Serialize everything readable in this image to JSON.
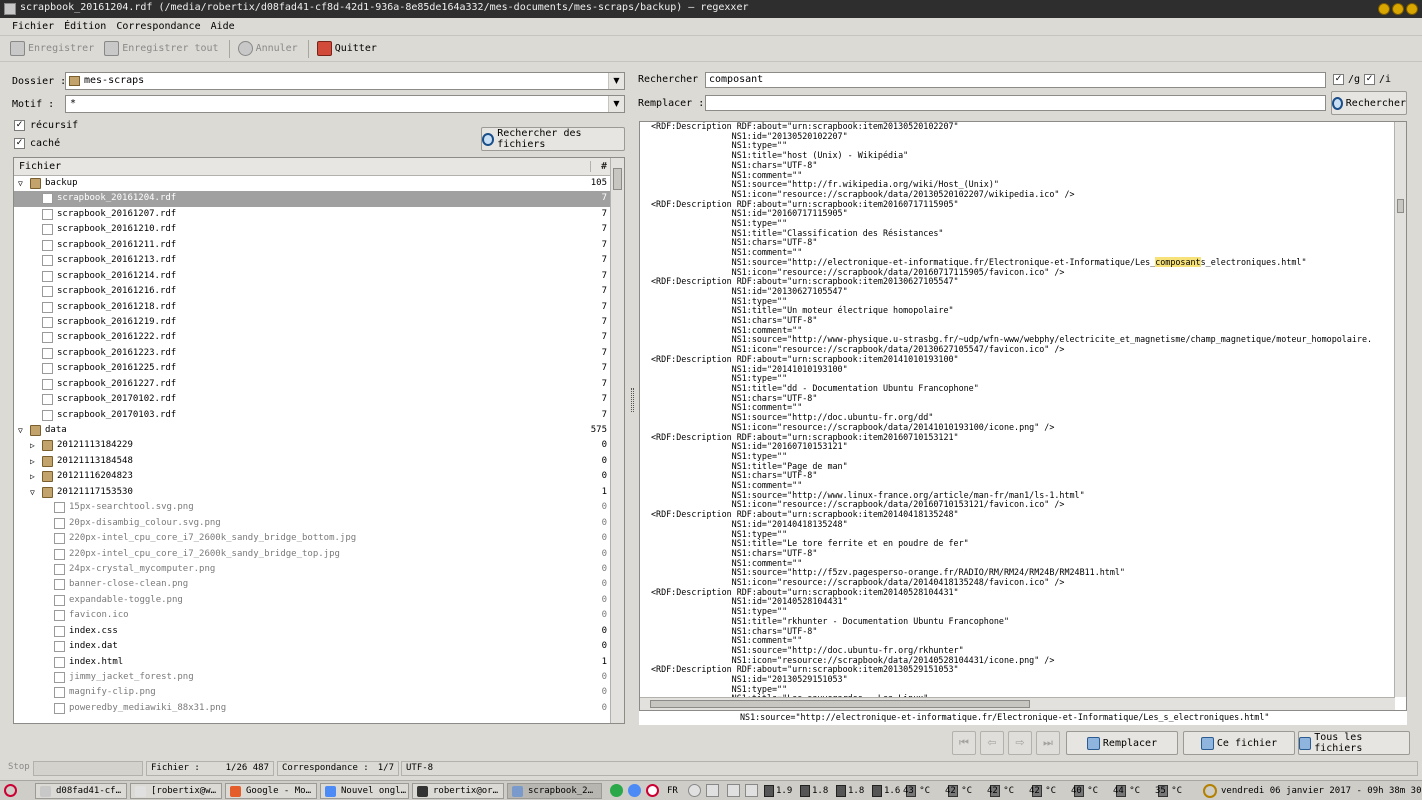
{
  "window": {
    "title": "scrapbook_20161204.rdf (/media/robertix/d08fad41-cf8d-42d1-936a-8e85de164a332/mes-documents/mes-scraps/backup) – regexxer"
  },
  "menu": [
    "Fichier",
    "Édition",
    "Correspondance",
    "Aide"
  ],
  "toolbar": {
    "save": "Enregistrer",
    "save_all": "Enregistrer tout",
    "undo": "Annuler",
    "quit": "Quitter"
  },
  "left": {
    "folder_label": "Dossier :",
    "folder_value": "mes-scraps",
    "pattern_label": "Motif :",
    "pattern_value": "*",
    "recursive_label": "récursif",
    "hidden_label": "caché",
    "find_files_btn": "Rechercher des fichiers",
    "col_file": "Fichier",
    "col_count": "#",
    "rows": [
      {
        "name": "backup",
        "count": "105",
        "type": "folder",
        "level": 0,
        "expander": "▽"
      },
      {
        "name": "scrapbook_20161204.rdf",
        "count": "7",
        "type": "file",
        "level": 1,
        "selected": true
      },
      {
        "name": "scrapbook_20161207.rdf",
        "count": "7",
        "type": "file",
        "level": 1
      },
      {
        "name": "scrapbook_20161210.rdf",
        "count": "7",
        "type": "file",
        "level": 1
      },
      {
        "name": "scrapbook_20161211.rdf",
        "count": "7",
        "type": "file",
        "level": 1
      },
      {
        "name": "scrapbook_20161213.rdf",
        "count": "7",
        "type": "file",
        "level": 1
      },
      {
        "name": "scrapbook_20161214.rdf",
        "count": "7",
        "type": "file",
        "level": 1
      },
      {
        "name": "scrapbook_20161216.rdf",
        "count": "7",
        "type": "file",
        "level": 1
      },
      {
        "name": "scrapbook_20161218.rdf",
        "count": "7",
        "type": "file",
        "level": 1
      },
      {
        "name": "scrapbook_20161219.rdf",
        "count": "7",
        "type": "file",
        "level": 1
      },
      {
        "name": "scrapbook_20161222.rdf",
        "count": "7",
        "type": "file",
        "level": 1
      },
      {
        "name": "scrapbook_20161223.rdf",
        "count": "7",
        "type": "file",
        "level": 1
      },
      {
        "name": "scrapbook_20161225.rdf",
        "count": "7",
        "type": "file",
        "level": 1
      },
      {
        "name": "scrapbook_20161227.rdf",
        "count": "7",
        "type": "file",
        "level": 1
      },
      {
        "name": "scrapbook_20170102.rdf",
        "count": "7",
        "type": "file",
        "level": 1
      },
      {
        "name": "scrapbook_20170103.rdf",
        "count": "7",
        "type": "file",
        "level": 1
      },
      {
        "name": "data",
        "count": "575",
        "type": "folder",
        "level": 0,
        "expander": "▽"
      },
      {
        "name": "20121113184229",
        "count": "0",
        "type": "folder",
        "level": 1,
        "expander": "▷"
      },
      {
        "name": "20121113184548",
        "count": "0",
        "type": "folder",
        "level": 1,
        "expander": "▷"
      },
      {
        "name": "20121116204823",
        "count": "0",
        "type": "folder",
        "level": 1,
        "expander": "▷"
      },
      {
        "name": "20121117153530",
        "count": "1",
        "type": "folder",
        "level": 1,
        "expander": "▽"
      },
      {
        "name": "15px-searchtool.svg.png",
        "count": "0",
        "type": "file",
        "level": 2,
        "dim": true
      },
      {
        "name": "20px-disambig_colour.svg.png",
        "count": "0",
        "type": "file",
        "level": 2,
        "dim": true
      },
      {
        "name": "220px-intel_cpu_core_i7_2600k_sandy_bridge_bottom.jpg",
        "count": "0",
        "type": "file",
        "level": 2,
        "dim": true
      },
      {
        "name": "220px-intel_cpu_core_i7_2600k_sandy_bridge_top.jpg",
        "count": "0",
        "type": "file",
        "level": 2,
        "dim": true
      },
      {
        "name": "24px-crystal_mycomputer.png",
        "count": "0",
        "type": "file",
        "level": 2,
        "dim": true
      },
      {
        "name": "banner-close-clean.png",
        "count": "0",
        "type": "file",
        "level": 2,
        "dim": true
      },
      {
        "name": "expandable-toggle.png",
        "count": "0",
        "type": "file",
        "level": 2,
        "dim": true
      },
      {
        "name": "favicon.ico",
        "count": "0",
        "type": "file",
        "level": 2,
        "dim": true
      },
      {
        "name": "index.css",
        "count": "0",
        "type": "file",
        "level": 2
      },
      {
        "name": "index.dat",
        "count": "0",
        "type": "file",
        "level": 2
      },
      {
        "name": "index.html",
        "count": "1",
        "type": "file",
        "level": 2
      },
      {
        "name": "jimmy_jacket_forest.png",
        "count": "0",
        "type": "file",
        "level": 2,
        "dim": true
      },
      {
        "name": "magnify-clip.png",
        "count": "0",
        "type": "file",
        "level": 2,
        "dim": true
      },
      {
        "name": "poweredby_mediawiki_88x31.png",
        "count": "0",
        "type": "file",
        "level": 2,
        "dim": true
      }
    ]
  },
  "right": {
    "search_label": "Rechercher :",
    "search_value": "composant",
    "flag_g": "/g",
    "flag_i": "/i",
    "replace_label": "Remplacer :",
    "replace_value": "",
    "search_btn": "Rechercher",
    "highlight": "composant",
    "text_lines": [
      "<RDF:Description RDF:about=\"urn:scrapbook:item20130520102207\"",
      "                NS1:id=\"20130520102207\"",
      "                NS1:type=\"\"",
      "                NS1:title=\"host (Unix) - Wikipédia\"",
      "                NS1:chars=\"UTF-8\"",
      "                NS1:comment=\"\"",
      "                NS1:source=\"http://fr.wikipedia.org/wiki/Host_(Unix)\"",
      "                NS1:icon=\"resource://scrapbook/data/20130520102207/wikipedia.ico\" />",
      "<RDF:Description RDF:about=\"urn:scrapbook:item20160717115905\"",
      "                NS1:id=\"20160717115905\"",
      "                NS1:type=\"\"",
      "                NS1:title=\"Classification des Résistances\"",
      "                NS1:chars=\"UTF-8\"",
      "                NS1:comment=\"\"",
      "                NS1:source=\"http://electronique-et-informatique.fr/Electronique-et-Informatique/Les_composants_electroniques.html\"",
      "                NS1:icon=\"resource://scrapbook/data/20160717115905/favicon.ico\" />",
      "<RDF:Description RDF:about=\"urn:scrapbook:item20130627105547\"",
      "                NS1:id=\"20130627105547\"",
      "                NS1:type=\"\"",
      "                NS1:title=\"Un moteur électrique homopolaire\"",
      "                NS1:chars=\"UTF-8\"",
      "                NS1:comment=\"\"",
      "                NS1:source=\"http://www-physique.u-strasbg.fr/~udp/wfn-www/webphy/electricite_et_magnetisme/champ_magnetique/moteur_homopolaire.",
      "                NS1:icon=\"resource://scrapbook/data/20130627105547/favicon.ico\" />",
      "<RDF:Description RDF:about=\"urn:scrapbook:item20141010193100\"",
      "                NS1:id=\"20141010193100\"",
      "                NS1:type=\"\"",
      "                NS1:title=\"dd - Documentation Ubuntu Francophone\"",
      "                NS1:chars=\"UTF-8\"",
      "                NS1:comment=\"\"",
      "                NS1:source=\"http://doc.ubuntu-fr.org/dd\"",
      "                NS1:icon=\"resource://scrapbook/data/20141010193100/icone.png\" />",
      "<RDF:Description RDF:about=\"urn:scrapbook:item20160710153121\"",
      "                NS1:id=\"20160710153121\"",
      "                NS1:type=\"\"",
      "                NS1:title=\"Page de man\"",
      "                NS1:chars=\"UTF-8\"",
      "                NS1:comment=\"\"",
      "                NS1:source=\"http://www.linux-france.org/article/man-fr/man1/ls-1.html\"",
      "                NS1:icon=\"resource://scrapbook/data/20160710153121/favicon.ico\" />",
      "<RDF:Description RDF:about=\"urn:scrapbook:item20140418135248\"",
      "                NS1:id=\"20140418135248\"",
      "                NS1:type=\"\"",
      "                NS1:title=\"Le tore ferrite et en poudre de fer\"",
      "                NS1:chars=\"UTF-8\"",
      "                NS1:comment=\"\"",
      "                NS1:source=\"http://f5zv.pagesperso-orange.fr/RADIO/RM/RM24/RM24B/RM24B11.html\"",
      "                NS1:icon=\"resource://scrapbook/data/20140418135248/favicon.ico\" />",
      "<RDF:Description RDF:about=\"urn:scrapbook:item20140528104431\"",
      "                NS1:id=\"20140528104431\"",
      "                NS1:type=\"\"",
      "                NS1:title=\"rkhunter - Documentation Ubuntu Francophone\"",
      "                NS1:chars=\"UTF-8\"",
      "                NS1:comment=\"\"",
      "                NS1:source=\"http://doc.ubuntu-fr.org/rkhunter\"",
      "                NS1:icon=\"resource://scrapbook/data/20140528104431/icone.png\" />",
      "<RDF:Description RDF:about=\"urn:scrapbook:item20130529151053\"",
      "                NS1:id=\"20130529151053\"",
      "                NS1:type=\"\"",
      "                NS1:title=\"Les sauvegardes - Lea Linux\""
    ],
    "preview": "NS1:source=\"http://electronique-et-informatique.fr/Electronique-et-Informatique/Les_s_electroniques.html\"",
    "replace_btn": "Remplacer",
    "this_file_btn": "Ce fichier",
    "all_files_btn": "Tous les fichiers"
  },
  "status": {
    "stop": "Stop",
    "file_label": "Fichier :",
    "file_value": "1/26 487",
    "match_label": "Correspondance :",
    "match_value": "1/7",
    "encoding": "UTF-8"
  },
  "taskbar": {
    "tasks": [
      {
        "label": "d08fad41-cf…",
        "color": "#c8c8c8"
      },
      {
        "label": "[robertix@w…",
        "color": "#e0e0e0"
      },
      {
        "label": "Google - Mo…",
        "color": "#e55d2b"
      },
      {
        "label": "Nouvel ongl…",
        "color": "#4c8bf5"
      },
      {
        "label": "robertix@or…",
        "color": "#333333"
      },
      {
        "label": "scrapbook_2…",
        "color": "#7a9acb",
        "active": true
      }
    ],
    "lang": "FR",
    "cpu": [
      "1.9",
      "1.8",
      "1.8",
      "1.6"
    ],
    "temps": [
      "43 °C",
      "42 °C",
      "42 °C",
      "42 °C",
      "40 °C",
      "44 °C",
      "35 °C"
    ],
    "clock": "vendredi 06 janvier 2017 - 09h 38m 30s"
  }
}
